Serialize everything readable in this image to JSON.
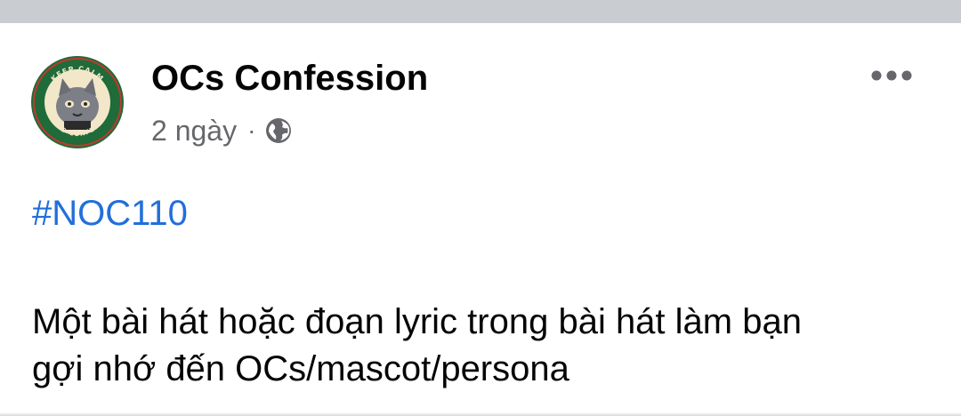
{
  "post": {
    "page_name": "OCs Confession",
    "time": "2 ngày",
    "separator": "·",
    "privacy_icon": "globe-icon",
    "more_icon": "more-horizontal-icon",
    "hashtag": "#NOC110",
    "body_lines": [
      "Một bài hát hoặc đoạn lyric trong bài hát làm bạn",
      "gợi nhớ đến OCs/mascot/persona"
    ],
    "avatar": {
      "logo_top_text": "KEEP CALM",
      "logo_bottom_text": "AND CONFESS",
      "logo_colors": {
        "ring": "#1f6b3a",
        "inner": "#f3e7c9",
        "accent": "#c0392b"
      }
    }
  },
  "colors": {
    "top_bar": "#c9ccd1",
    "hashtag": "#216fdb",
    "meta": "#65676b",
    "text": "#050505"
  }
}
